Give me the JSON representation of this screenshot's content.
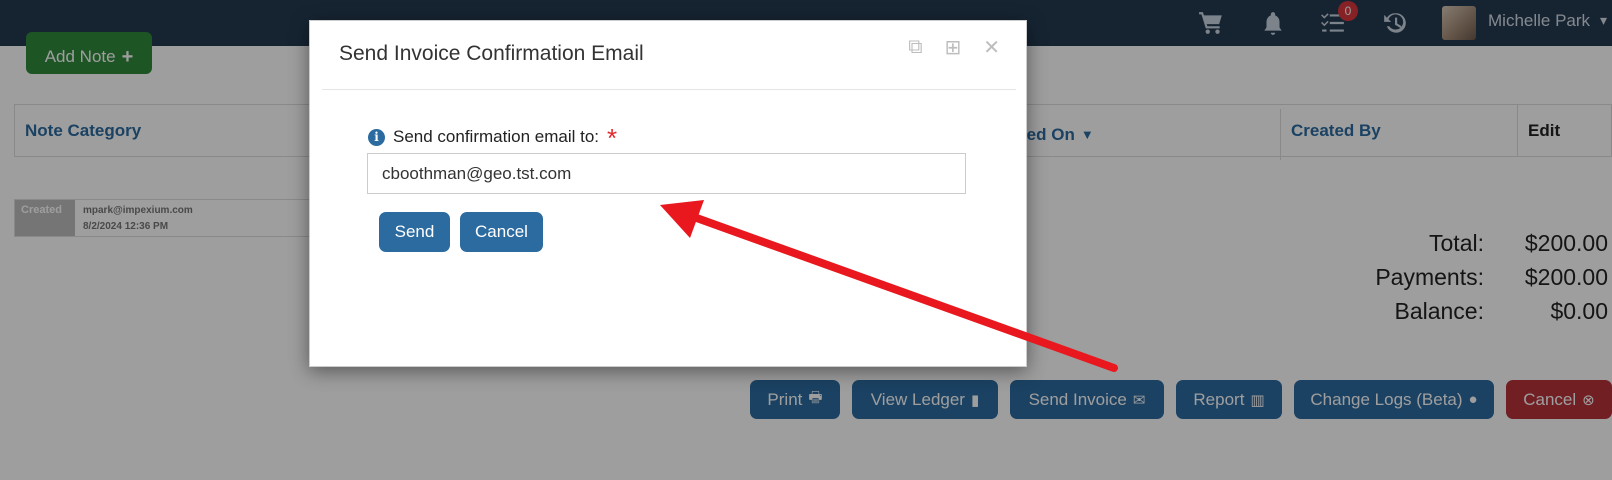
{
  "header": {
    "cart_icon": "cart-icon",
    "bell_icon": "bell-icon",
    "tasks_icon": "tasks-icon",
    "tasks_badge": "0",
    "history_icon": "history-icon",
    "user_name": "Michelle Park"
  },
  "page": {
    "add_note_label": "Add Note",
    "notes_table": {
      "columns": [
        "Note Category",
        "ted On",
        "Created By",
        "Edit"
      ],
      "row": {
        "category": "Created",
        "created_by": "mpark@impexium.com",
        "created_on": "8/2/2024 12:36 PM"
      }
    },
    "totals": [
      {
        "label": "Total:",
        "value": "$200.00"
      },
      {
        "label": "Payments:",
        "value": "$200.00"
      },
      {
        "label": "Balance:",
        "value": "$0.00"
      }
    ],
    "actions": [
      {
        "label": "Print",
        "icon": "print-icon"
      },
      {
        "label": "View Ledger",
        "icon": "book-icon"
      },
      {
        "label": "Send Invoice",
        "icon": "envelope-icon"
      },
      {
        "label": "Report",
        "icon": "chart-icon"
      },
      {
        "label": "Change Logs (Beta)",
        "icon": "circle-icon"
      },
      {
        "label": "Cancel",
        "icon": "times-circle-icon"
      }
    ]
  },
  "modal": {
    "title": "Send Invoice Confirmation Email",
    "field_label": "Send confirmation email to:",
    "required_mark": "*",
    "email_value": "cboothman@geo.tst.com",
    "send_label": "Send",
    "cancel_label": "Cancel"
  },
  "colors": {
    "nav_bg": "#243a52",
    "primary": "#2c6ba0",
    "success": "#2f8a3c",
    "danger": "#b8323a",
    "annotation_arrow": "#e8181e"
  }
}
